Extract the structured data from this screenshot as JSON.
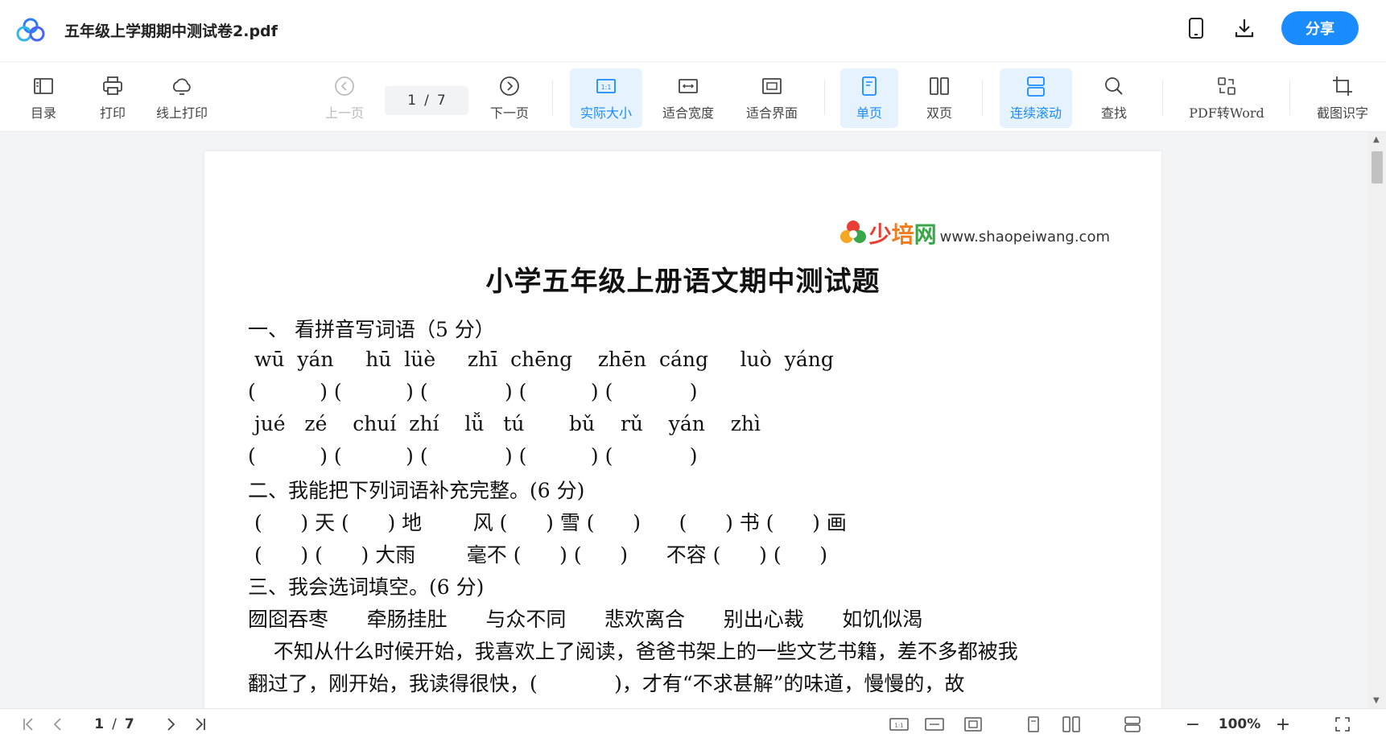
{
  "titlebar": {
    "file_name": "五年级上学期期中测试卷2.pdf",
    "share_label": "分享"
  },
  "toolbar": {
    "toc": "目录",
    "print": "打印",
    "online_print": "线上打印",
    "prev": "上一页",
    "page_current": "1",
    "page_sep": "/",
    "page_total": "7",
    "next": "下一页",
    "actual_size": "实际大小",
    "fit_width": "适合宽度",
    "fit_page": "适合界面",
    "single_page": "单页",
    "double_page": "双页",
    "continuous": "连续滚动",
    "find": "查找",
    "pdf_to_word": "PDF转Word",
    "ocr": "截图识字"
  },
  "document": {
    "brand_cn_1": "少",
    "brand_cn_2": "培",
    "brand_cn_3": "网",
    "brand_url": "www.shaopeiwang.com",
    "title": "小学五年级上册语文期中测试题",
    "lines": [
      "一、 看拼音写词语（5 分）",
      " wū  yán     hū  lüè     zhī  chēng    zhēn  cáng     luò  yáng",
      "(          ) (          ) (            ) (          ) (            )",
      " jué   zé    chuí  zhí    lǚ   tú       bǔ    rǔ    yán    zhì",
      "(          ) (          ) (            ) (          ) (            )",
      "二、我能把下列词语补充完整。(6 分)",
      " (      ) 天 (      ) 地        风 (      ) 雪 (      )      (      ) 书 (      ) 画",
      " (      ) (      ) 大雨        毫不 (      ) (      )      不容 (      ) (      )",
      "三、我会选词填空。(6 分)",
      "囫囵吞枣      牵肠挂肚      与众不同      悲欢离合      别出心裁      如饥似渴",
      "    不知从什么时候开始，我喜欢上了阅读，爸爸书架上的一些文艺书籍，差不多都被我",
      "翻过了，刚开始，我读得很快，(            )，才有“不求甚解”的味道，慢慢的，故"
    ]
  },
  "statusbar": {
    "page_current": "1",
    "page_sep": "/",
    "page_total": "7",
    "zoom": "100%"
  },
  "colors": {
    "accent": "#1a8cff",
    "active_bg": "#e6f3ff"
  }
}
